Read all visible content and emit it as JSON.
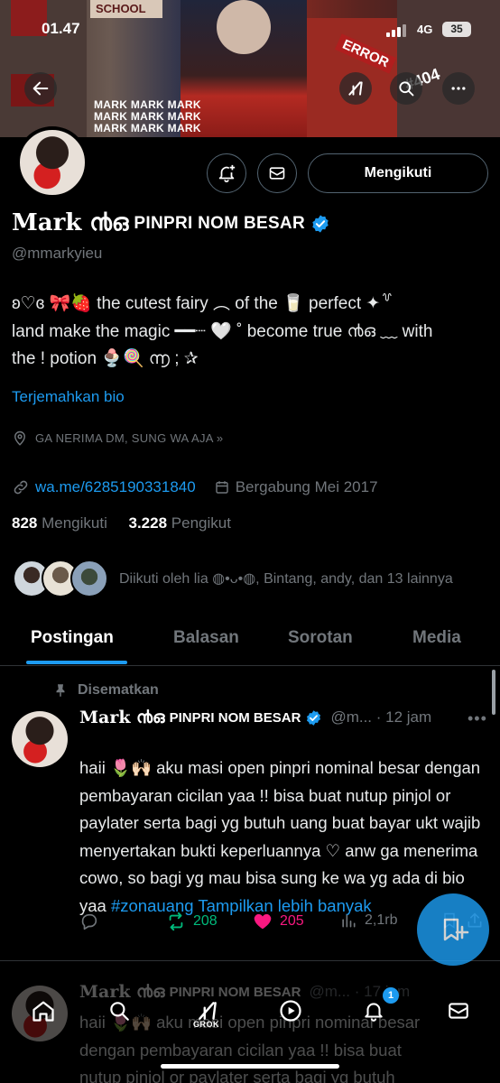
{
  "status_bar": {
    "time": "01.47",
    "network": "4G",
    "battery": "35"
  },
  "banner": {
    "mark_text": "MARK MARK MARK",
    "school": "SCHOOL",
    "error": "ERROR",
    "code": "#404"
  },
  "profile": {
    "display_name_script": "Mark ൯ഒ",
    "display_name_caps": "PINPRI NOM BESAR",
    "handle": "@mmarkyieu",
    "bio_line1": "ʚ♡ɞ 🎀🍓 the cutest fairy ︵ of the 🥛  perfect ✦꒷",
    "bio_line2": "land make the magic ━━┈ 🤍 ˚ become true ൯ഒ ﹏ with",
    "bio_line3": "the ! potion 🍨🍭 ൬ ; ✰",
    "translate": "Terjemahkan bio",
    "location": "GA NERIMA DM, SUNG WA AJA »",
    "website": "wa.me/6285190331840",
    "joined": "Bergabung Mei 2017",
    "following_count": "828",
    "following_label": "Mengikuti",
    "followers_count": "3.228",
    "followers_label": "Pengikut",
    "followed_by": "Diikuti oleh lia ◍•ᴗ•◍, Bintang, andy, dan 13 lainnya",
    "follow_button": "Mengikuti"
  },
  "tabs": [
    "Postingan",
    "Balasan",
    "Sorotan",
    "Media"
  ],
  "pinned_label": "Disematkan",
  "tweet": {
    "name_script": "Mark ൯ഒ",
    "name_caps": "PINPRI NOM BESAR",
    "handle_time": "@m... · 12 jam",
    "body": "haii 🌷🙌🏻 aku masi open pinpri nominal besar dengan pembayaran cicilan yaa !! bisa buat nutup pinjol or paylater serta bagi yg butuh uang buat bayar ukt wajib menyertakan bukti keperluannya ♡ anw ga menerima cowo, so bagi yg mau bisa sung ke wa yg ada di bio yaa",
    "hashtag": "#zonauang",
    "show_more": "Tampilkan lebih banyak",
    "retweets": "208",
    "likes": "205",
    "views": "2,1rb"
  },
  "tweet2": {
    "name_script": "Mark ൯ഒ",
    "name_caps": "PINPRI NOM BESAR",
    "handle_time": "@m... · 17 jam",
    "line1": "haii 🌷🙌🏻 aku masi open pinpri nominal besar",
    "line2": "dengan pembayaran cicilan yaa !! bisa buat",
    "line3": "nutup pinjol or paylater serta bagi yg butuh"
  },
  "bottom_nav": {
    "grok_label": "GROK",
    "notif_badge": "1"
  },
  "colors": {
    "accent": "#1d9bf0",
    "retweet": "#00ba7c",
    "like": "#f91880",
    "muted": "#71767b"
  },
  "icons": [
    "back-arrow-icon",
    "grok-icon",
    "search-icon",
    "more-icon",
    "notification-add-icon",
    "mail-icon",
    "verified-badge-icon",
    "location-icon",
    "link-icon",
    "calendar-icon",
    "pin-icon",
    "reply-icon",
    "retweet-icon",
    "heart-icon",
    "views-icon",
    "share-icon",
    "compose-icon",
    "home-icon",
    "communities-icon",
    "bell-icon"
  ]
}
